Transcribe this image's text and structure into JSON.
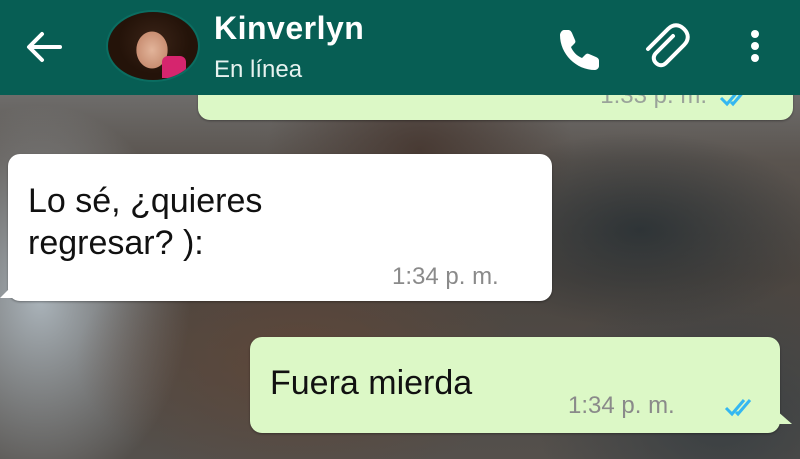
{
  "header": {
    "back_icon": "arrow-left-icon",
    "contact_name": "Kinverlyn",
    "contact_status": "En línea",
    "actions": [
      {
        "name": "call-button",
        "icon": "phone-icon"
      },
      {
        "name": "attach-button",
        "icon": "paperclip-icon"
      },
      {
        "name": "menu-button",
        "icon": "more-vert-icon"
      }
    ],
    "color": "#075e54"
  },
  "messages": [
    {
      "direction": "outgoing",
      "text": "",
      "time": "1:33 p. m.",
      "status": "read",
      "partially_visible": true
    },
    {
      "direction": "incoming",
      "text": "Lo sé, ¿quieres regresar? ):",
      "time": "1:34 p. m."
    },
    {
      "direction": "outgoing",
      "text": "Fuera mierda",
      "time": "1:34 p. m.",
      "status": "read"
    }
  ],
  "colors": {
    "incoming_bubble": "#ffffff",
    "outgoing_bubble": "#dcf8c6",
    "read_ticks": "#34b7f1"
  }
}
